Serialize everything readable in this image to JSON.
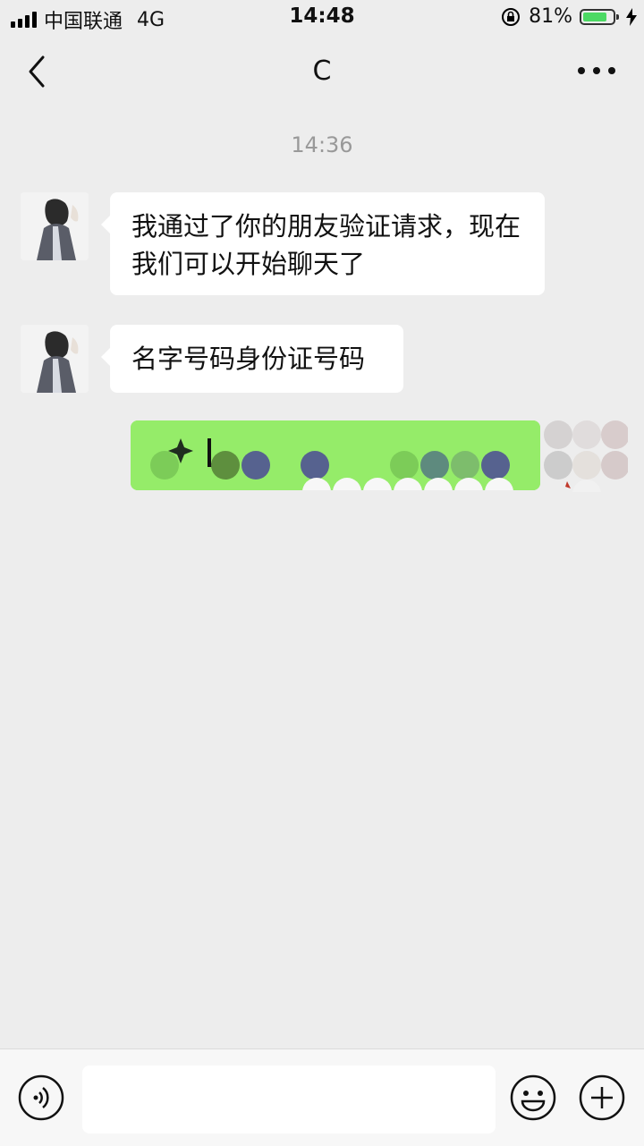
{
  "status_bar": {
    "carrier": "中国联通",
    "network": "4G",
    "time": "14:48",
    "battery": "81%",
    "battery_level": 0.81
  },
  "nav": {
    "title": "C"
  },
  "chat": {
    "timestamp": "14:36",
    "messages": [
      {
        "from": "contact",
        "text": "我通过了你的朋友验证请求，现在我们可以开始聊天了"
      },
      {
        "from": "contact",
        "text": "名字号码身份证号码"
      },
      {
        "from": "self",
        "text": ""
      }
    ]
  },
  "colors": {
    "background": "#ededed",
    "bubble_self": "#95ec69",
    "bubble_contact": "#ffffff",
    "battery_fill": "#4cd964"
  },
  "icons": [
    "back-chevron-icon",
    "more-dots-icon",
    "voice-icon",
    "emoji-icon",
    "plus-icon",
    "orientation-lock-icon",
    "charging-bolt-icon"
  ]
}
